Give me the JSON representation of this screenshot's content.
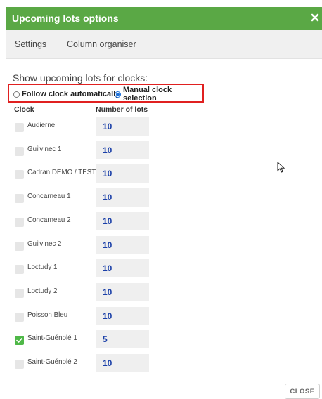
{
  "dialog": {
    "title": "Upcoming lots options",
    "close_icon": "close-x-icon"
  },
  "tabs": [
    {
      "label": "Settings"
    },
    {
      "label": "Column organiser"
    }
  ],
  "section": {
    "heading": "Show upcoming lots for clocks:"
  },
  "mode": {
    "options": [
      {
        "label": "Follow clock automatically",
        "selected": false
      },
      {
        "label": "Manual clock selection",
        "selected": true
      }
    ]
  },
  "table": {
    "headers": {
      "clock": "Clock",
      "lots": "Number of lots"
    },
    "rows": [
      {
        "clock": "Audierne",
        "lots": "10",
        "checked": false
      },
      {
        "clock": "Guilvinec 1",
        "lots": "10",
        "checked": false
      },
      {
        "clock": "Cadran DEMO / TEST",
        "lots": "10",
        "checked": false
      },
      {
        "clock": "Concarneau 1",
        "lots": "10",
        "checked": false
      },
      {
        "clock": "Concarneau 2",
        "lots": "10",
        "checked": false
      },
      {
        "clock": "Guilvinec 2",
        "lots": "10",
        "checked": false
      },
      {
        "clock": "Loctudy 1",
        "lots": "10",
        "checked": false
      },
      {
        "clock": "Loctudy 2",
        "lots": "10",
        "checked": false
      },
      {
        "clock": "Poisson Bleu",
        "lots": "10",
        "checked": false
      },
      {
        "clock": "Saint-Guénolé 1",
        "lots": "5",
        "checked": true
      },
      {
        "clock": "Saint-Guénolé 2",
        "lots": "10",
        "checked": false
      }
    ]
  },
  "footer": {
    "close_label": "CLOSE"
  },
  "colors": {
    "titlebar": "#5aa845",
    "checkbox_checked": "#4fb848",
    "highlight_border": "#e02020",
    "lots_text": "#1a3fa8"
  }
}
